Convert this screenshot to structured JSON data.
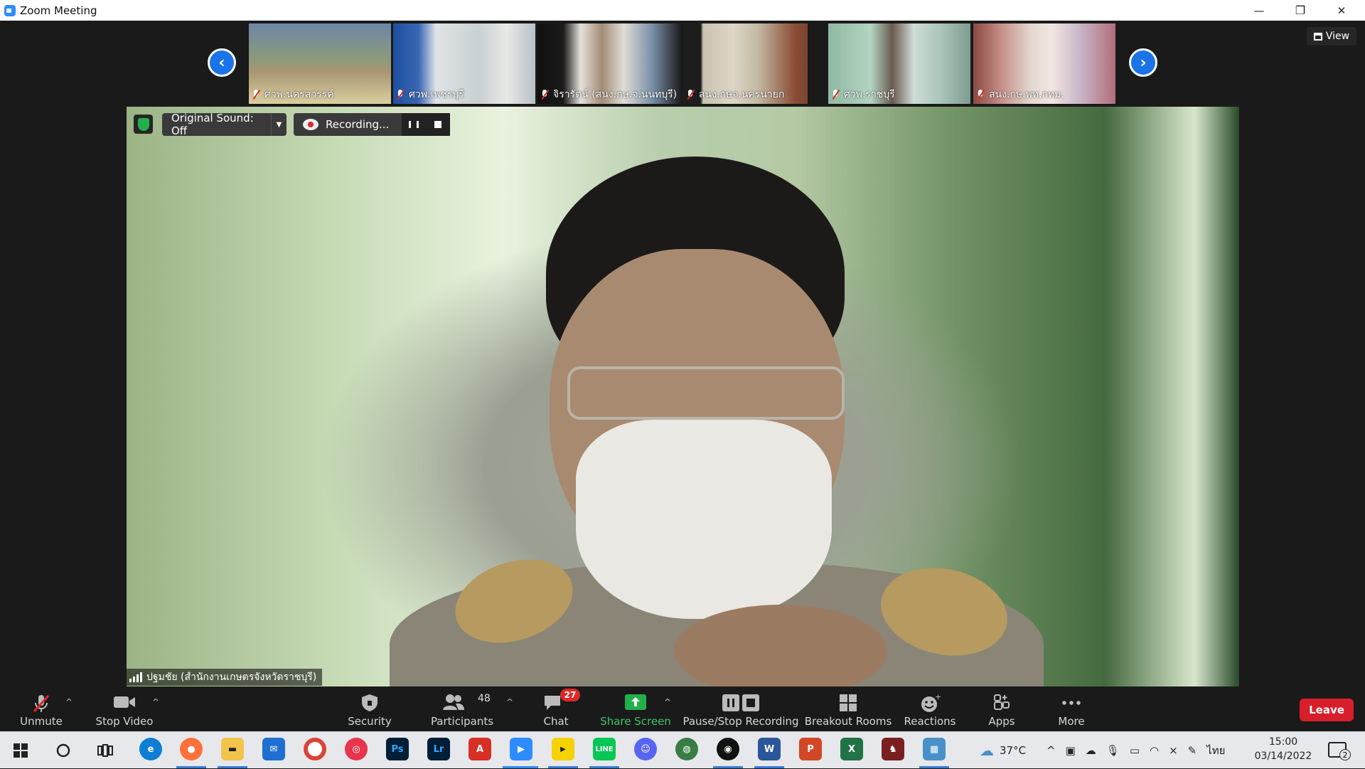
{
  "window": {
    "title": "Zoom Meeting",
    "minimize": "—",
    "restore": "❐",
    "close": "✕"
  },
  "view_button": {
    "label": "View"
  },
  "thumbnails": [
    {
      "name": "ศวพ.นครสวรรค์"
    },
    {
      "name": "ศวพ.เพชรบุรี"
    },
    {
      "name": "จิรารัตน์ (สนง.กษ.จ.นนทบุรี)"
    },
    {
      "name": "สนง.กษจ.นครนายก"
    },
    {
      "name": "ศวพ.ราชบุรี"
    },
    {
      "name": "สนง.กษ.พท.กทม."
    }
  ],
  "main_video": {
    "speaker_name": "ปฐมชัย (สำนักงานเกษตรจังหวัดราชบุรี)",
    "original_sound_label": "Original Sound: Off",
    "recording_label": "Recording..."
  },
  "toolbar": {
    "unmute": "Unmute",
    "stop_video": "Stop Video",
    "security": "Security",
    "participants": "Participants",
    "participants_count": "48",
    "chat": "Chat",
    "chat_badge": "27",
    "share_screen": "Share Screen",
    "pause_stop_recording": "Pause/Stop Recording",
    "breakout_rooms": "Breakout Rooms",
    "reactions": "Reactions",
    "apps": "Apps",
    "more": "More",
    "leave": "Leave"
  },
  "taskbar": {
    "weather": "37°C",
    "language": "ไทย",
    "time": "15:00",
    "date": "03/14/2022",
    "notification_count": "2",
    "apps": [
      "Edge",
      "Firefox",
      "File Explorer",
      "Mail",
      "Chrome",
      "Creative Cloud",
      "Photoshop",
      "Lightroom",
      "Acrobat",
      "Zoom",
      "Player",
      "LINE",
      "Discord",
      "Google Earth",
      "Camera",
      "Word",
      "PowerPoint",
      "Excel",
      "Game",
      "Photos"
    ]
  },
  "colors": {
    "accent": "#2d8cff",
    "leave": "#d81e2a",
    "share_green": "#23b04a",
    "badge_red": "#e02828"
  }
}
